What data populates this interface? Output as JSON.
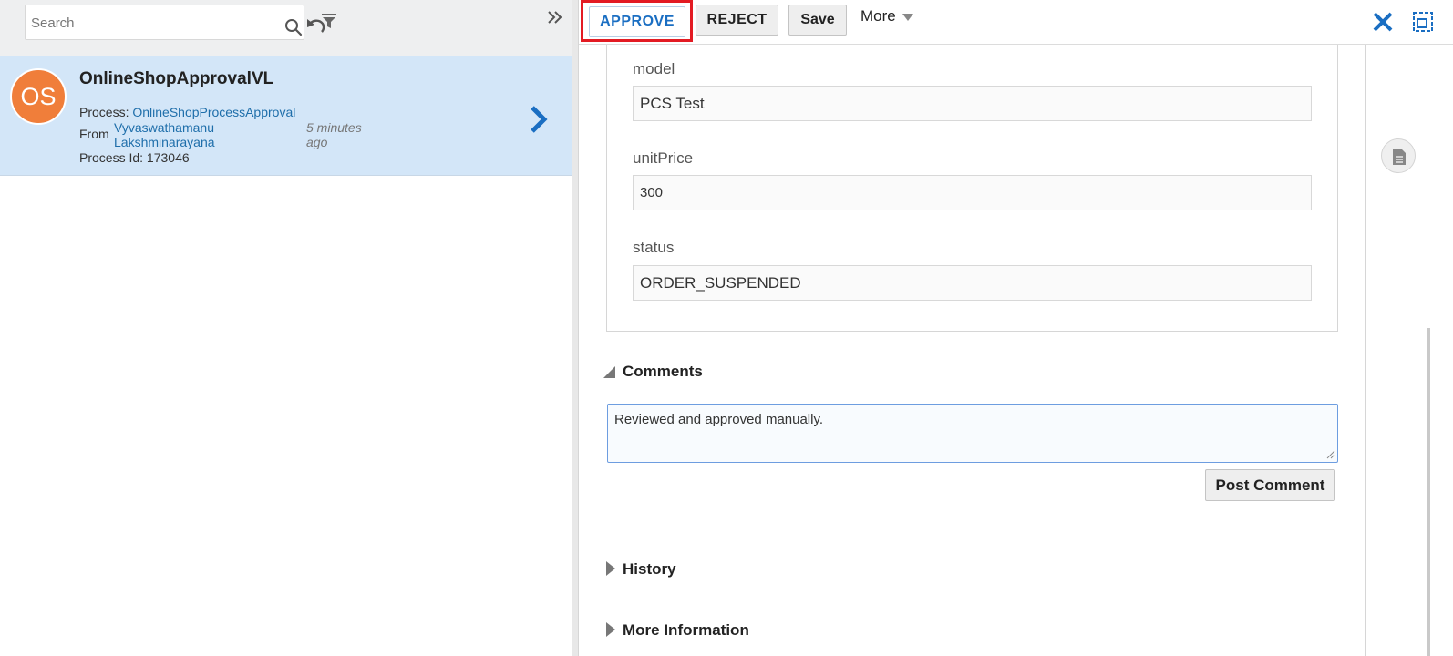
{
  "search": {
    "placeholder": "Search"
  },
  "task": {
    "avatar_initials": "OS",
    "title": "OnlineShopApprovalVL",
    "process_label": "Process:",
    "process_value": "OnlineShopProcessApproval",
    "from_label": "From",
    "from_value": "Vyvaswathamanu Lakshminarayana",
    "time_ago": "5 minutes ago",
    "process_id_label": "Process Id:",
    "process_id_value": "173046"
  },
  "toolbar": {
    "approve_label": "APPROVE",
    "reject_label": "REJECT",
    "save_label": "Save",
    "more_label": "More"
  },
  "form": {
    "model_label": "model",
    "model_value": "PCS Test",
    "unitprice_label": "unitPrice",
    "unitprice_value": "300",
    "status_label": "status",
    "status_value": "ORDER_SUSPENDED"
  },
  "comments": {
    "heading": "Comments",
    "text": "Reviewed and approved manually.",
    "post_label": "Post Comment"
  },
  "sections": {
    "history": "History",
    "more_information": "More Information"
  },
  "colors": {
    "accent_blue": "#1a6ec2",
    "avatar_orange": "#f07e3a",
    "selection_bg": "#d3e6f8",
    "highlight_red": "#e31b23"
  }
}
